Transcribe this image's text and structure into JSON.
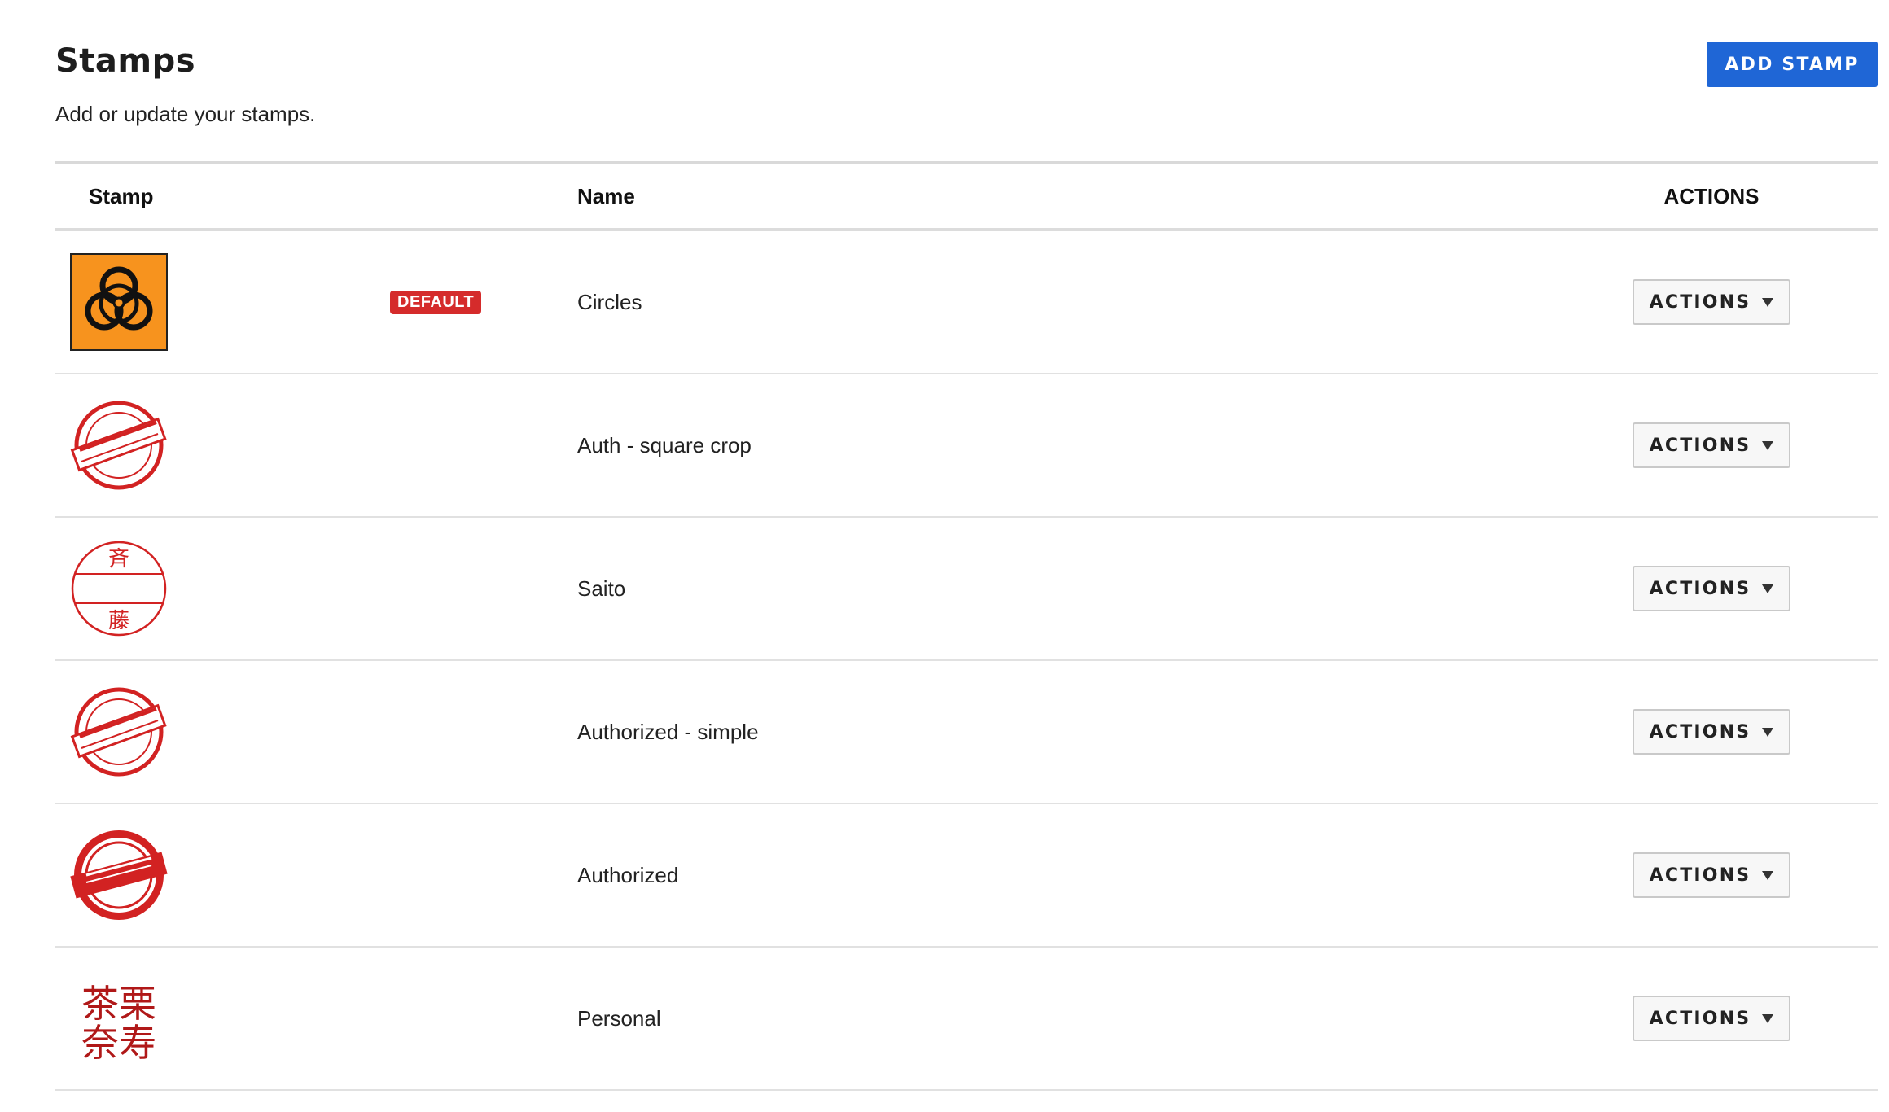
{
  "header": {
    "title": "Stamps",
    "subtitle": "Add or update your stamps.",
    "add_button_label": "ADD STAMP"
  },
  "table": {
    "columns": {
      "stamp": "Stamp",
      "name": "Name",
      "actions": "ACTIONS"
    },
    "rows": [
      {
        "name": "Circles",
        "stamp_image": "biohazard-stamp-icon",
        "badge": "DEFAULT",
        "action_label": "ACTIONS"
      },
      {
        "name": "Auth - square crop",
        "stamp_image": "authorized-red-stamp-icon",
        "action_label": "ACTIONS"
      },
      {
        "name": "Saito",
        "stamp_image": "saito-hanko-stamp-icon",
        "action_label": "ACTIONS",
        "stamp_text_top": "斉",
        "stamp_text_bottom": "藤"
      },
      {
        "name": "Authorized - simple",
        "stamp_image": "authorized-red-stamp-icon",
        "action_label": "ACTIONS"
      },
      {
        "name": "Authorized",
        "stamp_image": "authorized-red-seal-icon",
        "action_label": "ACTIONS"
      },
      {
        "name": "Personal",
        "stamp_image": "personal-kanji-stamp-icon",
        "action_label": "ACTIONS",
        "stamp_text_line1": "茶栗",
        "stamp_text_line2": "奈寿"
      }
    ]
  },
  "colors": {
    "primary": "#1f66d6",
    "badge": "#d52b2b",
    "stamp_red": "#d22222",
    "stamp_orange": "#f7931e"
  }
}
